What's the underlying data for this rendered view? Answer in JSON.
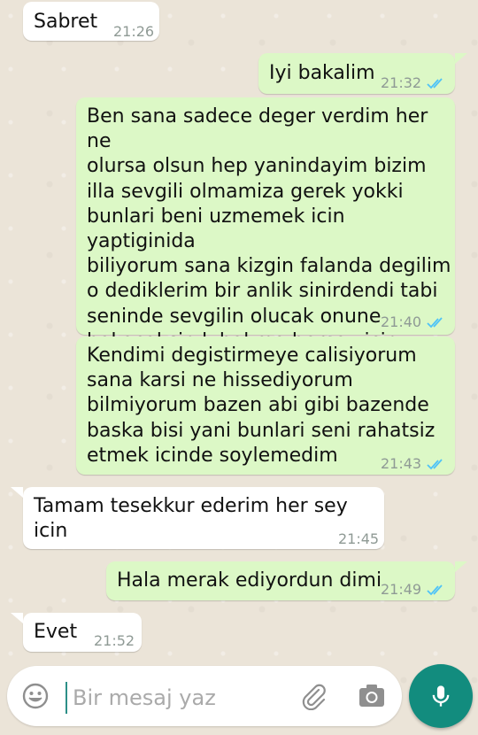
{
  "messages": [
    {
      "direction": "in",
      "text": "Sabret",
      "time": "21:26"
    },
    {
      "direction": "out",
      "text": "Iyi bakalim",
      "time": "21:32"
    },
    {
      "direction": "out",
      "text": "Ben sana sadece deger verdim her ne\nolursa olsun hep yanindayim  bizim\nilla sevgili olmamiza gerek yokki\nbunlari beni uzmemek icin yaptiginida\nbiliyorum sana kizgin falanda degilim\no dediklerim bir anlik sinirdendi tabi\nseninde sevgilin olucak onune\nbakacaksin k.bakma hersey icin",
      "time": "21:40"
    },
    {
      "direction": "out",
      "text": "Kendimi degistirmeye calisiyorum\nsana karsi ne hissediyorum\nbilmiyorum bazen abi gibi bazende\nbaska bisi yani bunlari seni rahatsiz\netmek icinde soylemedim",
      "time": "21:43"
    },
    {
      "direction": "in",
      "text": "Tamam tesekkur ederim her sey icin",
      "time": "21:45"
    },
    {
      "direction": "out",
      "text": "Hala merak ediyordun dimi",
      "time": "21:49"
    },
    {
      "direction": "in",
      "text": "Evet",
      "time": "21:52"
    }
  ],
  "composer": {
    "placeholder": "Bir mesaj yaz",
    "emoji_icon": "emoji-icon",
    "attach_icon": "paperclip-icon",
    "camera_icon": "camera-icon",
    "mic_icon": "mic-icon"
  },
  "colors": {
    "incoming": "#ffffff",
    "outgoing": "#dcf8c6",
    "tick": "#4fc3f7",
    "accent": "#128c7e"
  }
}
